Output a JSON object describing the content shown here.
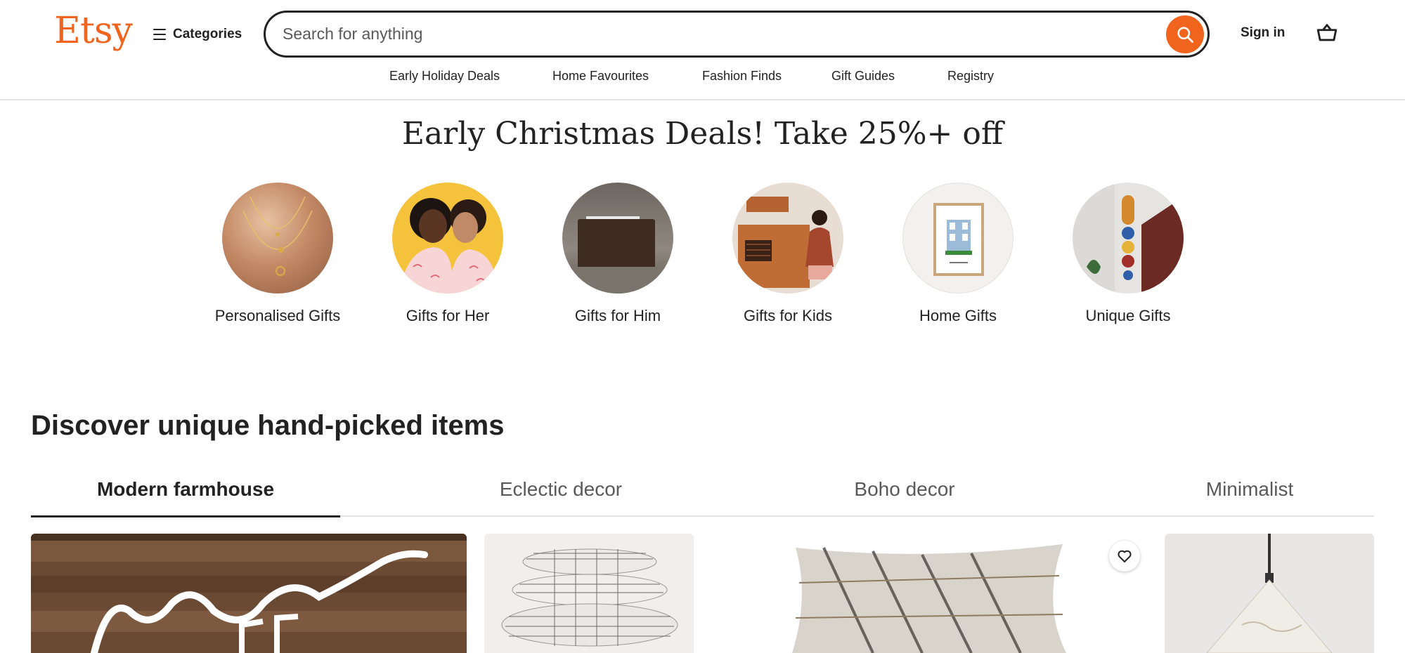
{
  "header": {
    "logo": "Etsy",
    "categories_label": "Categories",
    "search_placeholder": "Search for anything",
    "sign_in": "Sign in",
    "nav": [
      "Early Holiday Deals",
      "Home Favourites",
      "Fashion Finds",
      "Gift Guides",
      "Registry"
    ]
  },
  "hero": {
    "title": "Early Christmas Deals! Take 25%+ off",
    "circles": [
      {
        "label": "Personalised Gifts",
        "image": "gold-necklace-photo"
      },
      {
        "label": "Gifts for Her",
        "image": "women-pajamas-photo"
      },
      {
        "label": "Gifts for Him",
        "image": "leather-wallet-photo"
      },
      {
        "label": "Gifts for Kids",
        "image": "toy-kitchen-photo"
      },
      {
        "label": "Home Gifts",
        "image": "framed-house-print-photo"
      },
      {
        "label": "Unique Gifts",
        "image": "wall-hanging-photo"
      }
    ]
  },
  "discover": {
    "title": "Discover unique hand-picked items",
    "tabs": [
      "Modern farmhouse",
      "Eclectic decor",
      "Boho decor",
      "Minimalist"
    ],
    "active_tab": "Modern farmhouse"
  },
  "colors": {
    "brand": "#f1641e",
    "text": "#222222",
    "muted": "#595959"
  }
}
